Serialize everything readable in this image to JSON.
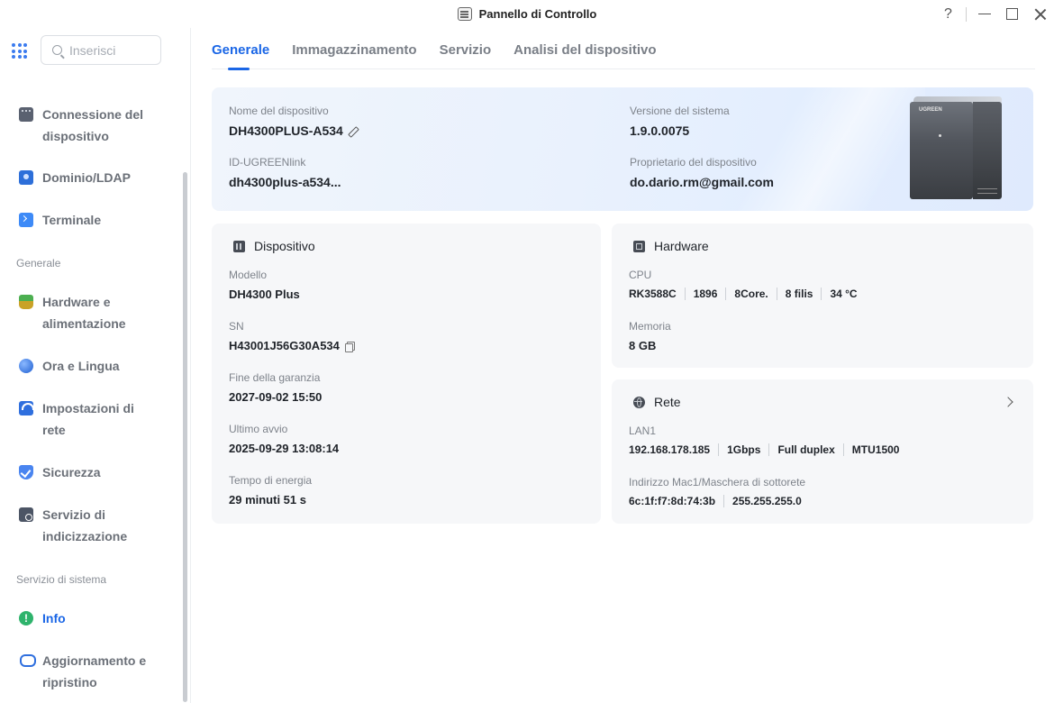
{
  "window": {
    "title": "Pannello di Controllo",
    "icon": "control-panel-icon"
  },
  "window_controls": {
    "help": "?"
  },
  "sidebar": {
    "search_placeholder": "Inserisci",
    "items": [
      {
        "label": "Connessione del dispositivo",
        "icon": "device-connection-icon"
      },
      {
        "label": "Dominio/LDAP",
        "icon": "domain-ldap-icon"
      },
      {
        "label": "Terminale",
        "icon": "terminal-icon"
      },
      {
        "label": "Hardware e alimentazione",
        "icon": "hardware-power-icon"
      },
      {
        "label": "Ora e Lingua",
        "icon": "time-language-icon"
      },
      {
        "label": "Impostazioni di rete",
        "icon": "network-settings-icon"
      },
      {
        "label": "Sicurezza",
        "icon": "security-icon"
      },
      {
        "label": "Servizio di indicizzazione",
        "icon": "indexing-service-icon"
      },
      {
        "label": "Info",
        "icon": "info-icon",
        "active": true
      },
      {
        "label": "Aggiornamento e ripristino",
        "icon": "update-restore-icon"
      }
    ],
    "sections": {
      "generale": "Generale",
      "servizio": "Servizio di sistema"
    }
  },
  "tabs": [
    {
      "label": "Generale",
      "active": true
    },
    {
      "label": "Immagazzinamento"
    },
    {
      "label": "Servizio"
    },
    {
      "label": "Analisi del dispositivo"
    }
  ],
  "overview": {
    "device_name_label": "Nome del dispositivo",
    "device_name": "DH4300PLUS-A534",
    "ugreenlink_label": "ID-UGREENlink",
    "ugreenlink": "dh4300plus-a534...",
    "system_version_label": "Versione del sistema",
    "system_version": "1.9.0.0075",
    "owner_label": "Proprietario del dispositivo",
    "owner": "do.dario.rm@gmail.com",
    "device_image_brand": "UGREEN"
  },
  "device_card": {
    "title": "Dispositivo",
    "model_label": "Modello",
    "model": "DH4300 Plus",
    "sn_label": "SN",
    "sn": "H43001J56G30A534",
    "warranty_label": "Fine della garanzia",
    "warranty": "2027-09-02 15:50",
    "last_boot_label": "Ultimo avvio",
    "last_boot": "2025-09-29 13:08:14",
    "uptime_label": "Tempo di energia",
    "uptime": "29 minuti 51 s"
  },
  "hardware_card": {
    "title": "Hardware",
    "cpu_label": "CPU",
    "cpu": [
      "RK3588C",
      "1896",
      "8Core.",
      "8 filis",
      "34 °C"
    ],
    "memory_label": "Memoria",
    "memory": "8 GB"
  },
  "network_card": {
    "title": "Rete",
    "lan_label": "LAN1",
    "lan": [
      "192.168.178.185",
      "1Gbps",
      "Full duplex",
      "MTU1500"
    ],
    "mac_label": "Indirizzo Mac1/Maschera di sottorete",
    "mac": [
      "6c:1f:f7:8d:74:3b",
      "255.255.255.0"
    ]
  },
  "colors": {
    "accent": "#1a66e6",
    "card_bg": "#f6f7f9",
    "text_muted": "#7e838b"
  }
}
